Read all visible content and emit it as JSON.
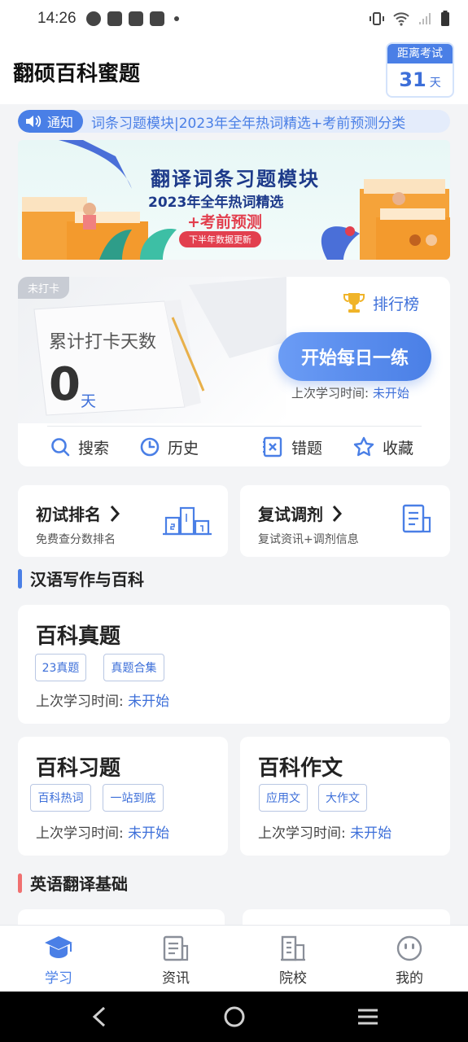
{
  "status_bar": {
    "time": "14:26"
  },
  "header": {
    "title": "翻硕百科蜜题",
    "countdown": {
      "label": "距离考试",
      "days": "31",
      "unit": "天"
    }
  },
  "notice": {
    "tag": "通知",
    "text": "词条习题模块|2023年全年热词精选+考前预测分类"
  },
  "banner": {
    "line1": "翻译词条习题模块",
    "line2": "2023年全年热词精选",
    "line3": "+考前预测",
    "line4": "下半年数据更新"
  },
  "checkin": {
    "status_badge": "未打卡",
    "rank_label": "排行榜",
    "days_label": "累计打卡天数",
    "days_value": "0",
    "days_unit": "天",
    "start_button": "开始每日一练",
    "last_study_label": "上次学习时间:",
    "last_study_value": "未开始",
    "tools": [
      {
        "label": "搜索",
        "icon": "search-icon"
      },
      {
        "label": "历史",
        "icon": "history-icon"
      },
      {
        "label": "错题",
        "icon": "mistakes-icon"
      },
      {
        "label": "收藏",
        "icon": "star-icon"
      }
    ]
  },
  "quick_cards": [
    {
      "title": "初试排名",
      "subtitle": "免费查分数排名",
      "icon": "podium-icon"
    },
    {
      "title": "复试调剂",
      "subtitle": "复试资讯+调剂信息",
      "icon": "document-icon"
    }
  ],
  "sections": [
    {
      "title": "汉语写作与百科",
      "bar_color": "#4a7fe6"
    },
    {
      "title": "英语翻译基础",
      "bar_color": "#f07070"
    }
  ],
  "subject_cards": {
    "real_questions": {
      "title": "百科真题",
      "tags": [
        "23真题",
        "真题合集"
      ],
      "last_label": "上次学习时间:",
      "last_value": "未开始"
    },
    "exercises": {
      "title": "百科习题",
      "tags": [
        "百科热词",
        "一站到底"
      ],
      "last_label": "上次学习时间:",
      "last_value": "未开始"
    },
    "essay": {
      "title": "百科作文",
      "tags": [
        "应用文",
        "大作文"
      ],
      "last_label": "上次学习时间:",
      "last_value": "未开始"
    }
  },
  "tabbar": {
    "items": [
      {
        "label": "学习",
        "icon": "graduation-cap-icon",
        "active": true
      },
      {
        "label": "资讯",
        "icon": "news-icon",
        "active": false
      },
      {
        "label": "院校",
        "icon": "school-icon",
        "active": false
      },
      {
        "label": "我的",
        "icon": "profile-icon",
        "active": false
      }
    ]
  },
  "colors": {
    "accent": "#4a7fe6",
    "accent_dark": "#3d6fd9",
    "gold": "#f0b429"
  }
}
